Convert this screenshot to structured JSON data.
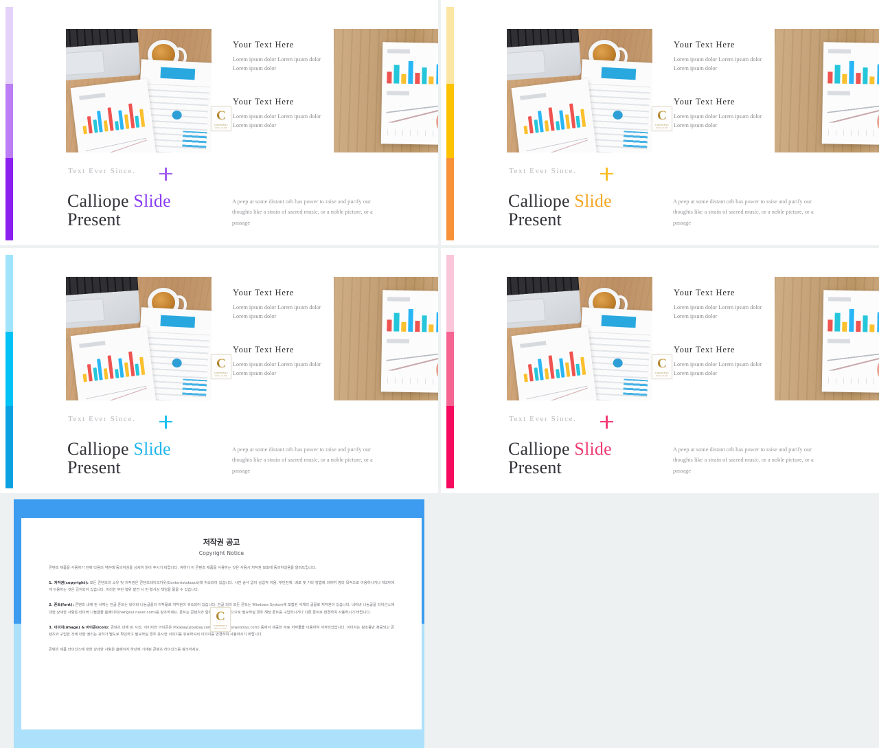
{
  "meta": {
    "deck_title": "Calliope Slide Present"
  },
  "slides": [
    {
      "id": "slide-top-left",
      "accent": {
        "light": "#e4d2fb",
        "mid": "#bb7ef5",
        "dark": "#8b1ff0"
      },
      "blocks": [
        {
          "heading": "Your Text Here",
          "body": "Lorem ipsum dolor Lorem ipsum dolor Lorem ipsum dolor"
        },
        {
          "heading": "Your Text Here",
          "body": "Lorem ipsum dolor Lorem ipsum dolor Lorem ipsum dolor"
        }
      ],
      "eyebrow": "Text Ever Since.",
      "plus_icon": "plus-icon",
      "title_main": "Calliope ",
      "title_accent": "Slide",
      "title_second": "Present",
      "paragraph": "A peep at some distant orb has power to raise and purify our thoughts like a strain of sacred music, or a noble picture, or a passage"
    },
    {
      "id": "slide-top-right",
      "accent": {
        "light": "#fbe6a3",
        "mid": "#fdc300",
        "dark": "#f79238"
      },
      "blocks": [
        {
          "heading": "Your Text Here",
          "body": "Lorem ipsum dolor Lorem ipsum dolor Lorem ipsum dolor"
        },
        {
          "heading": "Your Text Here",
          "body": "Lorem ipsum dolor Lorem ipsum dolor Lorem ipsum dolor"
        }
      ],
      "eyebrow": "Text Ever Since.",
      "plus_icon": "plus-icon",
      "title_main": "Calliope ",
      "title_accent": "Slide",
      "title_second": "Present",
      "paragraph": "A peep at some distant orb has power to raise and purify our thoughts like a strain of sacred music, or a noble picture, or a passage"
    },
    {
      "id": "slide-bottom-left",
      "accent": {
        "light": "#9fe4fb",
        "mid": "#00c2f5",
        "dark": "#0ca2e2"
      },
      "blocks": [
        {
          "heading": "Your Text Here",
          "body": "Lorem ipsum dolor Lorem ipsum dolor Lorem ipsum dolor"
        },
        {
          "heading": "Your Text Here",
          "body": "Lorem ipsum dolor Lorem ipsum dolor Lorem ipsum dolor"
        }
      ],
      "eyebrow": "Text Ever Since.",
      "plus_icon": "plus-icon",
      "title_main": "Calliope ",
      "title_accent": "Slide",
      "title_second": "Present",
      "paragraph": "A peep at some distant orb has power to raise and purify our thoughts like a strain of sacred music, or a noble picture, or a passage"
    },
    {
      "id": "slide-bottom-right",
      "accent": {
        "light": "#fbc6da",
        "mid": "#f46592",
        "dark": "#f50a5e"
      },
      "blocks": [
        {
          "heading": "Your Text Here",
          "body": "Lorem ipsum dolor Lorem ipsum dolor Lorem ipsum dolor"
        },
        {
          "heading": "Your Text Here",
          "body": "Lorem ipsum dolor Lorem ipsum dolor Lorem ipsum dolor"
        }
      ],
      "eyebrow": "Text Ever Since.",
      "plus_icon": "plus-icon",
      "title_main": "Calliope ",
      "title_accent": "Slide",
      "title_second": "Present",
      "paragraph": "A peep at some distant orb has power to raise and purify our thoughts like a strain of sacred music, or a noble picture, or a passage"
    }
  ],
  "watermark": {
    "letter": "C",
    "line1": "CONTENTS",
    "line2": "REAL CLUB"
  },
  "copyright": {
    "frame_color_top": "#3d9bf0",
    "frame_color_bottom": "#ade0fb",
    "title": "저작권 공고",
    "subtitle": "Copyright Notice",
    "intro": "콘텐츠 제품을 사용하기 전에 다음의 약관에 동의하심을 상세히 읽어 주시기 바랍니다. 귀하가 이 콘텐츠 제품을 사용하는 것은 사용시 저작권 보호에 동의하셨음을 알려드립니다.",
    "section1_label": "1. 저작권(copyright):",
    "section1": "모든 콘텐츠의 소유 및 저작권은 콘텐츠테이크아웃(Contentstakeout)에 귀속되어 있습니다. 사전 승낙 없이 상업적 이용, 무단전재, 배포 및 기타 방법에 의하여 영리 목적으로 이용하시거나 제3자에게 이용하는 것은 금지되어 있습니다. 이러한 무단 행위 발견 시 민·형사상 책임을 물을 수 있습니다.",
    "section2_label": "2. 폰트(font):",
    "section2": "콘텐츠 내에 된 서체는 한글 폰트는 네이버 나눔글꼴의 저작물로 저작권이 귀속되어 있습니다. 한글 외의 모든 폰트는 Windows System에 포함된 서체의 글꼴로 저작권이 있습니다. 네이버 나눔글꼴 라이선스에 대한 상세한 사항은 네이버 나눔글꼴 홈페이지(hangeul.naver.com)를 참조하세요. 폰트는 콘텐츠와 함께 제공되지 않으므로 필요하실 경우 해당 폰트를 구입하시거나 다른 폰트로 변경하여 사용하시기 바랍니다.",
    "section3_label": "3. 이미지(image) & 아이콘(icon):",
    "section3": "콘텐츠 내에 된 사진, 이미지와 아이콘은 Pixabay(pixabay.com)와 Webolys(webolys.com) 등에서 제공한 무료 저작물을 이용하여 저작되었습니다. 이미지는 참조용만 제공되고 콘텐츠와 구입한 것에 대한 권리는 귀하가 별도로 확인하고 필요하실 경우 유사한 이미지를 유료하셔서 이미지를 변경하여 사용하시기 바랍니다.",
    "footer": "콘텐츠 제품 라이선스에 대한 상세한 사항은 홈페이지 하단에 기재된 콘텐츠 라이선스를 참조하세요."
  }
}
